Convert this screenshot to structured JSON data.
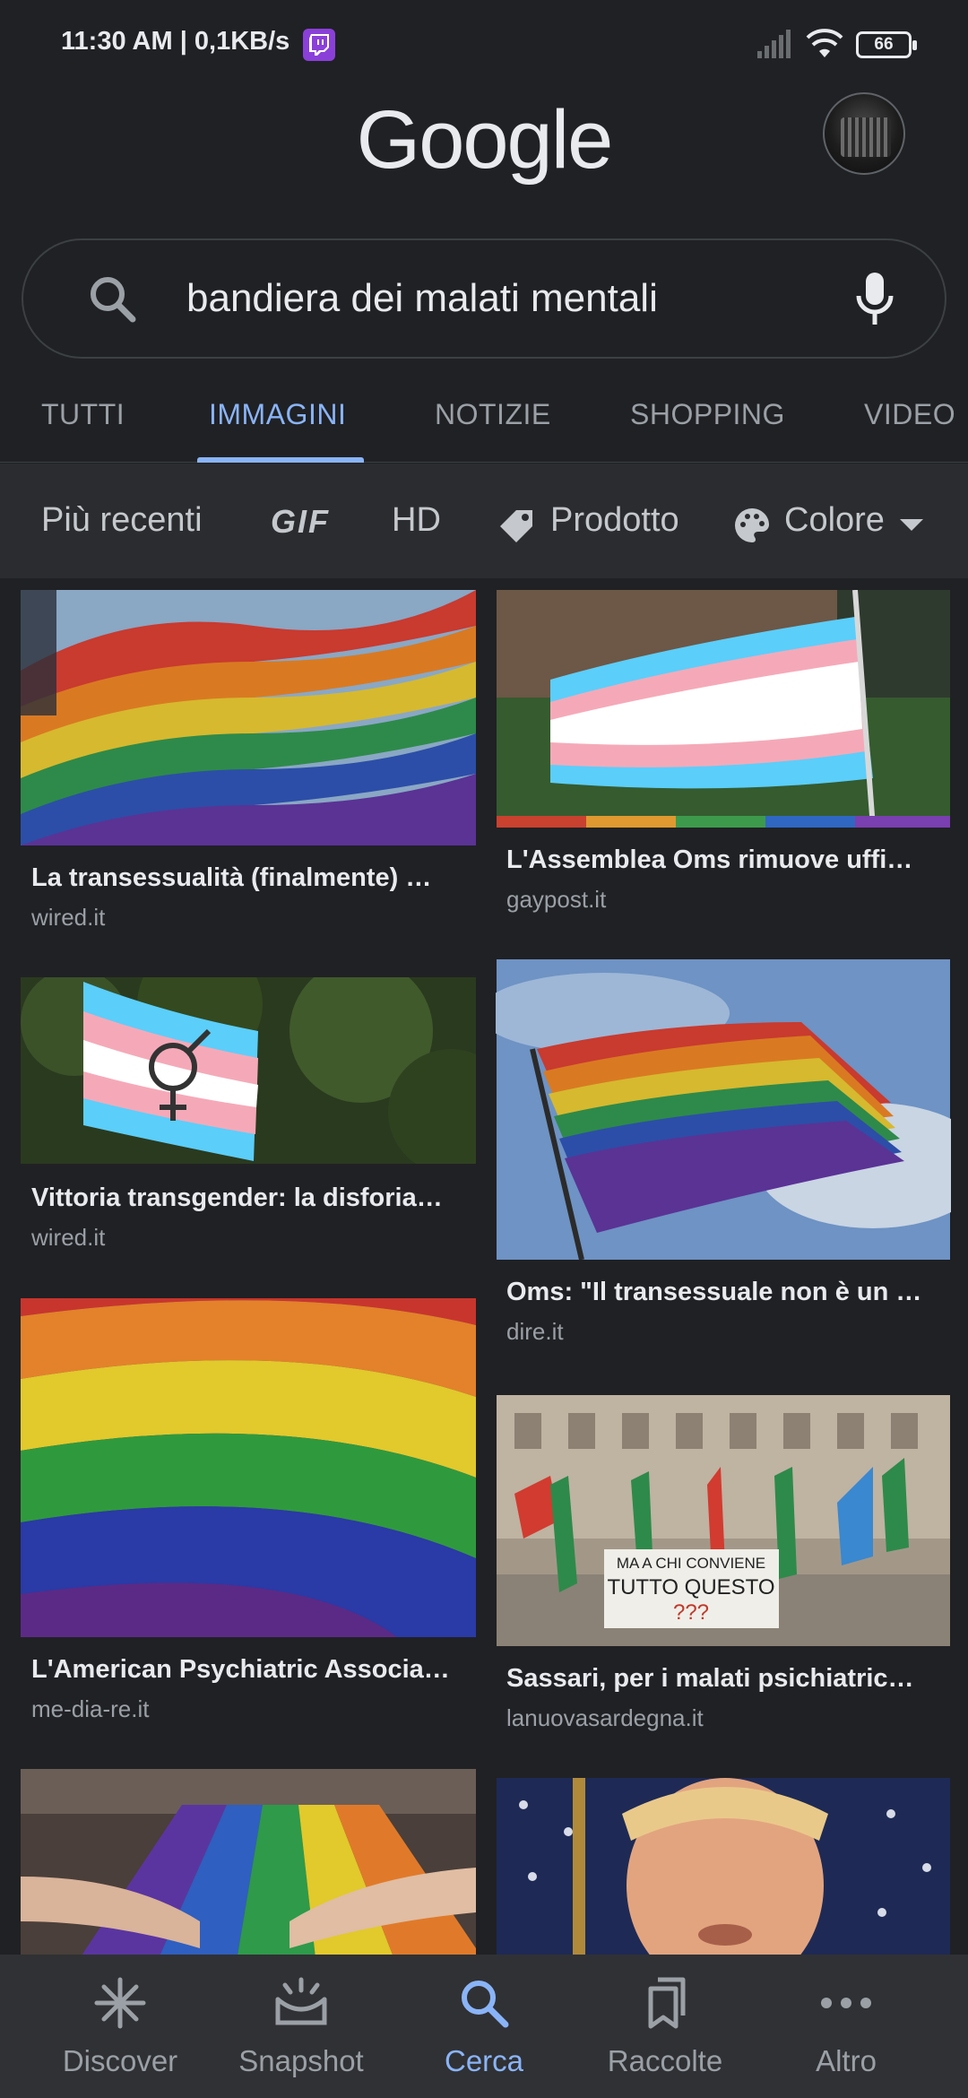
{
  "status_bar": {
    "time": "11:30 AM | 0,1KB/s",
    "battery": "66",
    "icons": [
      "twitch-icon",
      "signal-icon",
      "wifi-icon",
      "battery-icon"
    ]
  },
  "header": {
    "logo": "Google",
    "avatar": "account-avatar"
  },
  "search": {
    "query": "bandiera dei malati mentali",
    "icons": [
      "search-icon",
      "mic-icon"
    ]
  },
  "tabs": [
    {
      "label": "TUTTI",
      "active": false
    },
    {
      "label": "IMMAGINI",
      "active": true
    },
    {
      "label": "NOTIZIE",
      "active": false
    },
    {
      "label": "SHOPPING",
      "active": false
    },
    {
      "label": "VIDEO",
      "active": false
    }
  ],
  "filters": {
    "recent": "Più recenti",
    "gif": "GIF",
    "hd": "HD",
    "product": "Prodotto",
    "color": "Colore"
  },
  "results": [
    {
      "title": "La transessualità (finalmente) …",
      "source": "wired.it"
    },
    {
      "title": "L'Assemblea Oms rimuove uffi…",
      "source": "gaypost.it"
    },
    {
      "title": "Vittoria transgender: la disforia…",
      "source": "wired.it"
    },
    {
      "title": "Oms: \"Il transessuale non è un …",
      "source": "dire.it"
    },
    {
      "title": "L'American Psychiatric Associa…",
      "source": "me-dia-re.it"
    },
    {
      "title": "Sassari, per i malati psichiatric…",
      "source": "lanuovasardegna.it",
      "banner": [
        "MA A CHI CONVIENE",
        "TUTTO QUESTO",
        "???"
      ]
    },
    {
      "title": "",
      "source": ""
    },
    {
      "title": "",
      "source": ""
    }
  ],
  "bottom_nav": [
    {
      "label": "Discover",
      "icon": "asterisk-icon",
      "active": false
    },
    {
      "label": "Snapshot",
      "icon": "snapshot-icon",
      "active": false
    },
    {
      "label": "Cerca",
      "icon": "search-icon",
      "active": true
    },
    {
      "label": "Raccolte",
      "icon": "bookmarks-icon",
      "active": false
    },
    {
      "label": "Altro",
      "icon": "more-icon",
      "active": false
    }
  ],
  "colors": {
    "background": "#202124",
    "accent": "#8ab4f8",
    "text": "#e8eaed",
    "muted": "#9aa0a6"
  }
}
